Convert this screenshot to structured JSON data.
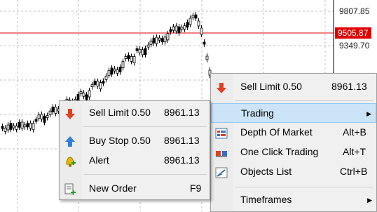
{
  "axis": {
    "labels": [
      "9807.85",
      "9349.70"
    ],
    "current_price": "9505.87"
  },
  "colors": {
    "price_line": "#e00000",
    "candle": "#000000",
    "grid": "#c0c0c0",
    "menu_bg": "#f0f0f0",
    "highlight": "#cce4f7"
  },
  "menu_main": {
    "items": [
      {
        "icon": "sell-arrow-icon",
        "label": "Sell Limit 0.50",
        "value": "8961.13"
      },
      {
        "label": "Trading",
        "submenu": true
      },
      {
        "icon": "depth-of-market-icon",
        "label": "Depth Of Market",
        "shortcut": "Alt+B"
      },
      {
        "icon": "one-click-trading-icon",
        "label": "One Click Trading",
        "shortcut": "Alt+T"
      },
      {
        "icon": "objects-list-icon",
        "label": "Objects List",
        "shortcut": "Ctrl+B"
      },
      {
        "label": "Timeframes",
        "submenu": true
      }
    ]
  },
  "menu_trading": {
    "items": [
      {
        "icon": "sell-arrow-icon",
        "label": "Sell Limit 0.50",
        "value": "8961.13"
      },
      {
        "icon": "buy-arrow-icon",
        "label": "Buy Stop 0.50",
        "value": "8961.13"
      },
      {
        "icon": "alert-bell-icon",
        "label": "Alert",
        "value": "8961.13"
      },
      {
        "icon": "new-order-icon",
        "label": "New Order",
        "shortcut": "F9"
      }
    ]
  }
}
